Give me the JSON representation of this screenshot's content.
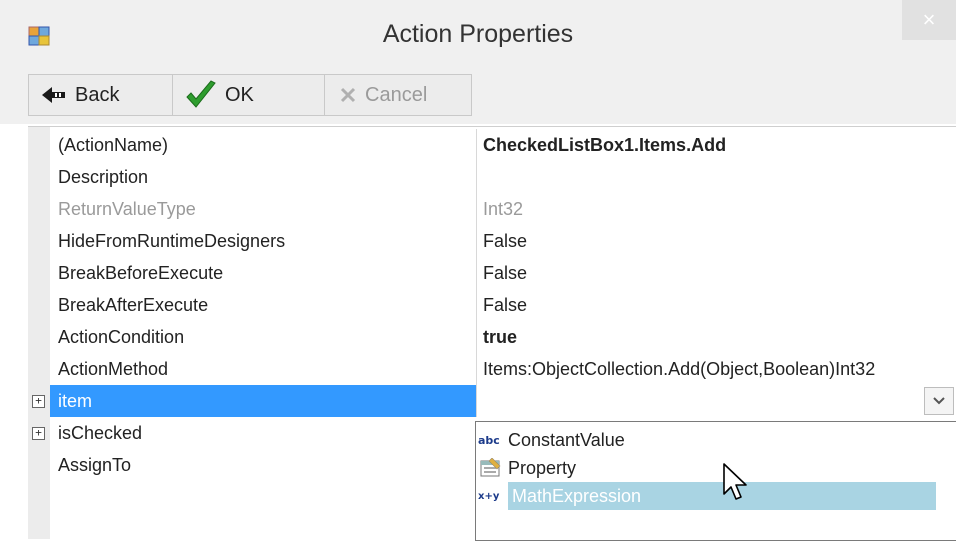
{
  "window": {
    "title": "Action Properties",
    "close_glyph": "×",
    "icon": "form-icon"
  },
  "toolbar": {
    "back_label": "Back",
    "ok_label": "OK",
    "cancel_label": "Cancel"
  },
  "properties": [
    {
      "name": "(ActionName)",
      "value": "CheckedListBox1.Items.Add",
      "bold": true
    },
    {
      "name": "Description",
      "value": ""
    },
    {
      "name": "ReturnValueType",
      "value": "Int32",
      "disabled": true
    },
    {
      "name": "HideFromRuntimeDesigners",
      "value": "False"
    },
    {
      "name": "BreakBeforeExecute",
      "value": "False"
    },
    {
      "name": "BreakAfterExecute",
      "value": "False"
    },
    {
      "name": "ActionCondition",
      "value": "true",
      "bold": true
    },
    {
      "name": "ActionMethod",
      "value": "Items:ObjectCollection.Add(Object,Boolean)Int32"
    },
    {
      "name": "item",
      "value": "",
      "selected": true,
      "expandable": true
    },
    {
      "name": "isChecked",
      "value": "",
      "expandable": true
    },
    {
      "name": "AssignTo",
      "value": ""
    }
  ],
  "expander_glyph": "+",
  "dropdown": {
    "arrow_glyph": "⌵",
    "items": [
      {
        "label": "ConstantValue",
        "icon": "abc-icon"
      },
      {
        "label": "Property",
        "icon": "property-icon"
      },
      {
        "label": "MathExpression",
        "icon": "xy-icon",
        "highlighted": true
      }
    ]
  },
  "colors": {
    "selection": "#3399ff",
    "dropdown_highlight": "#a9d4e3"
  }
}
